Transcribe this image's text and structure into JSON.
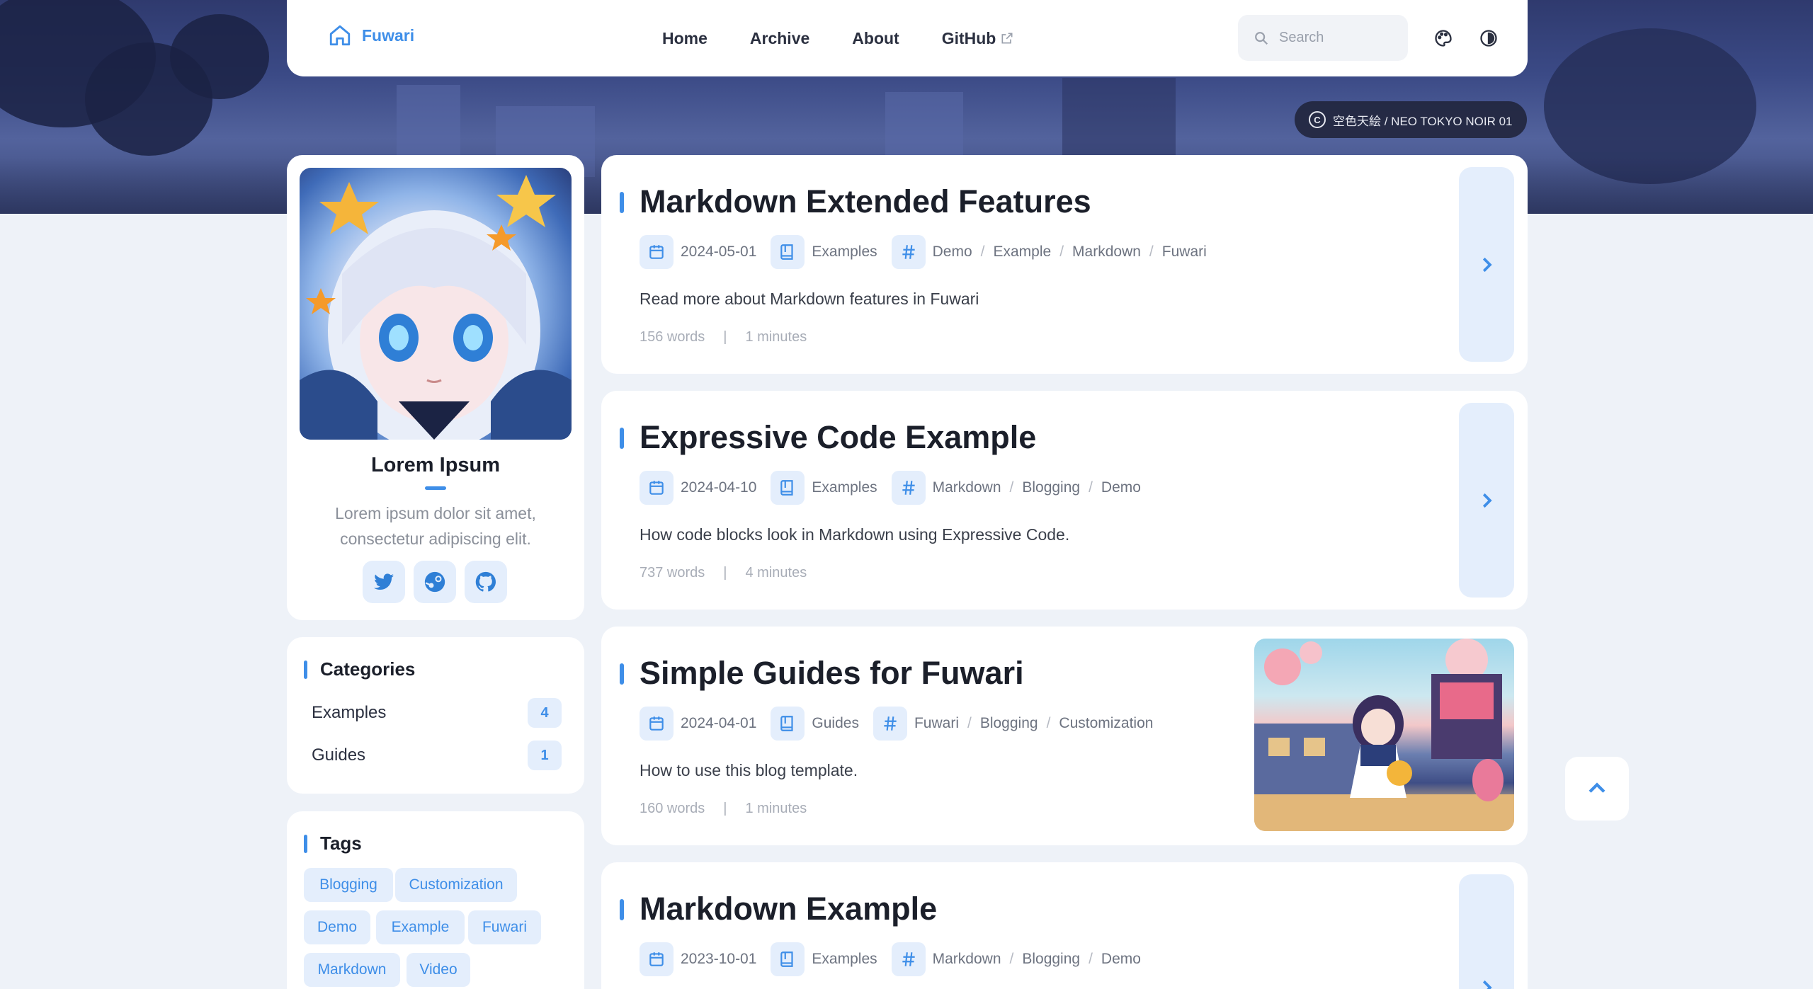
{
  "brand": {
    "name": "Fuwari"
  },
  "nav": {
    "links": [
      "Home",
      "Archive",
      "About",
      "GitHub"
    ]
  },
  "search": {
    "placeholder": "Search"
  },
  "banner": {
    "credit": "空色天絵 / NEO TOKYO NOIR 01",
    "credit_icon": "copyright-icon"
  },
  "profile": {
    "name": "Lorem Ipsum",
    "bio": "Lorem ipsum dolor sit amet, consectetur adipiscing elit.",
    "socials": [
      "twitter-icon",
      "steam-icon",
      "github-icon"
    ]
  },
  "categories": {
    "title": "Categories",
    "items": [
      {
        "name": "Examples",
        "count": "4"
      },
      {
        "name": "Guides",
        "count": "1"
      }
    ]
  },
  "tags": {
    "title": "Tags",
    "items": [
      "Blogging",
      "Customization",
      "Demo",
      "Example",
      "Fuwari",
      "Markdown",
      "Video"
    ]
  },
  "posts": [
    {
      "title": "Markdown Extended Features",
      "date": "2024-05-01",
      "category": "Examples",
      "tags": [
        "Demo",
        "Example",
        "Markdown",
        "Fuwari"
      ],
      "excerpt": "Read more about Markdown features in Fuwari",
      "words": "156 words",
      "time": "1 minutes"
    },
    {
      "title": "Expressive Code Example",
      "date": "2024-04-10",
      "category": "Examples",
      "tags": [
        "Markdown",
        "Blogging",
        "Demo"
      ],
      "excerpt": "How code blocks look in Markdown using Expressive Code.",
      "words": "737 words",
      "time": "4 minutes"
    },
    {
      "title": "Simple Guides for Fuwari",
      "date": "2024-04-01",
      "category": "Guides",
      "tags": [
        "Fuwari",
        "Blogging",
        "Customization"
      ],
      "excerpt": "How to use this blog template.",
      "words": "160 words",
      "time": "1 minutes"
    },
    {
      "title": "Markdown Example",
      "date": "2023-10-01",
      "category": "Examples",
      "tags": [
        "Markdown",
        "Blogging",
        "Demo"
      ]
    }
  ],
  "colors": {
    "accent": "#3e8ee8",
    "accent_bg": "#e4eefc",
    "page_bg": "#eef2f8"
  }
}
